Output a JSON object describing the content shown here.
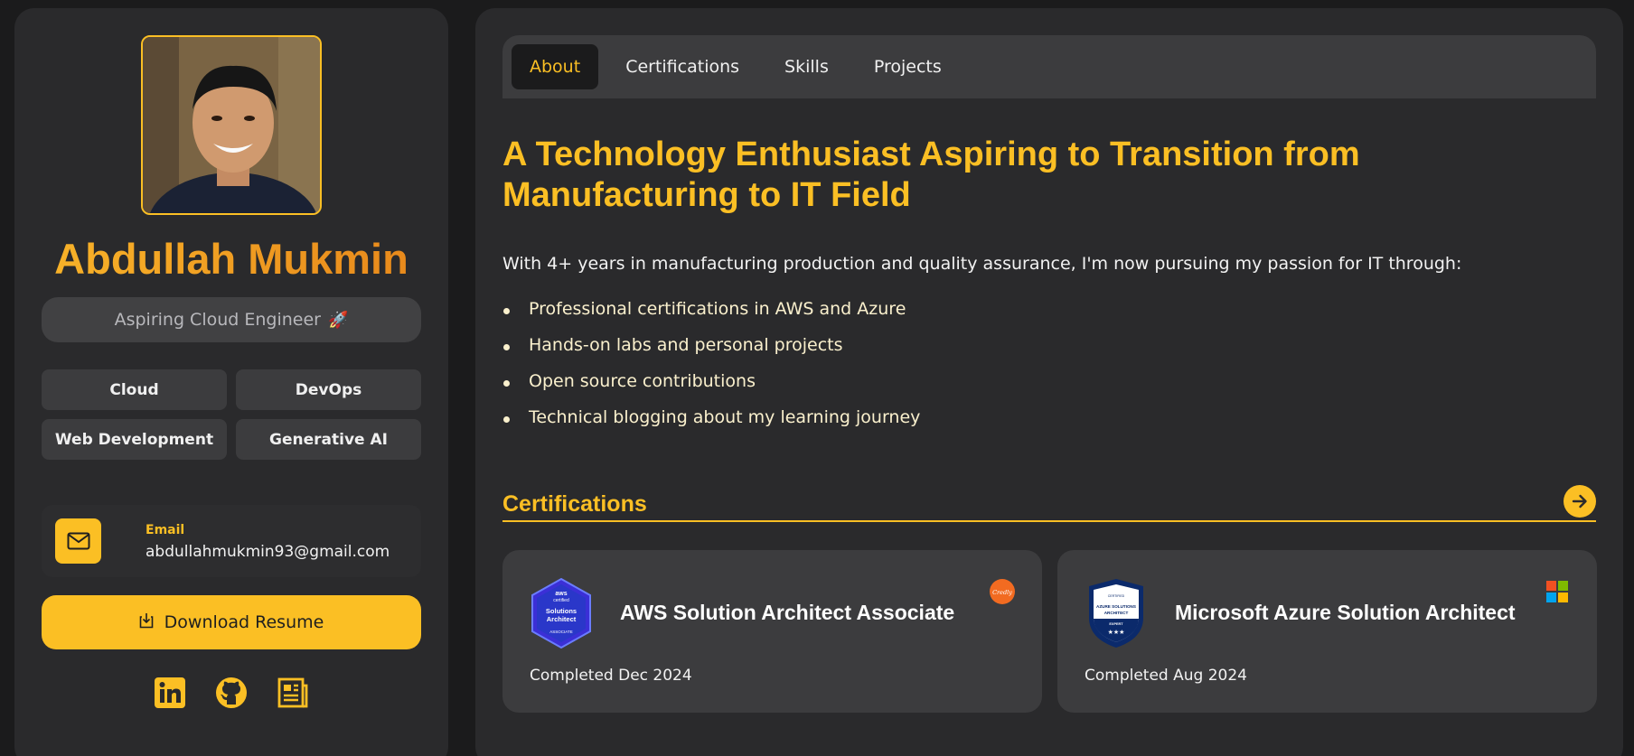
{
  "profile": {
    "name": "Abdullah Mukmin",
    "role": "Aspiring Cloud Engineer",
    "role_emoji": "🚀",
    "tags": [
      "Cloud",
      "DevOps",
      "Web Development",
      "Generative AI"
    ],
    "contact": {
      "label": "Email",
      "value": "abdullahmukmin93@gmail.com",
      "icon": "mail-icon"
    },
    "download_label": "Download Resume",
    "socials": [
      "linkedin-icon",
      "github-icon",
      "blog-icon"
    ]
  },
  "tabs": [
    {
      "label": "About",
      "active": true
    },
    {
      "label": "Certifications",
      "active": false
    },
    {
      "label": "Skills",
      "active": false
    },
    {
      "label": "Projects",
      "active": false
    }
  ],
  "about": {
    "headline": "A Technology Enthusiast Aspiring to Transition from Manufacturing to IT Field",
    "intro": "With 4+ years in manufacturing production and quality assurance, I'm now pursuing my passion for IT through:",
    "bullets": [
      "Professional certifications in AWS and Azure",
      "Hands-on labs and personal projects",
      "Open source contributions",
      "Technical blogging about my learning journey"
    ]
  },
  "certifications": {
    "title": "Certifications",
    "items": [
      {
        "title": "AWS Solution Architect Associate",
        "date": "Completed Dec 2024",
        "badge_text": [
          "aws",
          "certified",
          "Solutions",
          "Architect",
          "ASSOCIATE"
        ],
        "issuer_text": "Credly"
      },
      {
        "title": "Microsoft Azure Solution Architect",
        "date": "Completed Aug 2024",
        "badge_text": [
          "Microsoft",
          "CERTIFIED",
          "AZURE SOLUTIONS",
          "ARCHITECT",
          "EXPERT"
        ],
        "issuer_text": "Microsoft"
      }
    ]
  },
  "colors": {
    "accent": "#fbbf24",
    "panel": "#2a2a2c",
    "background": "#1b1b1c"
  }
}
